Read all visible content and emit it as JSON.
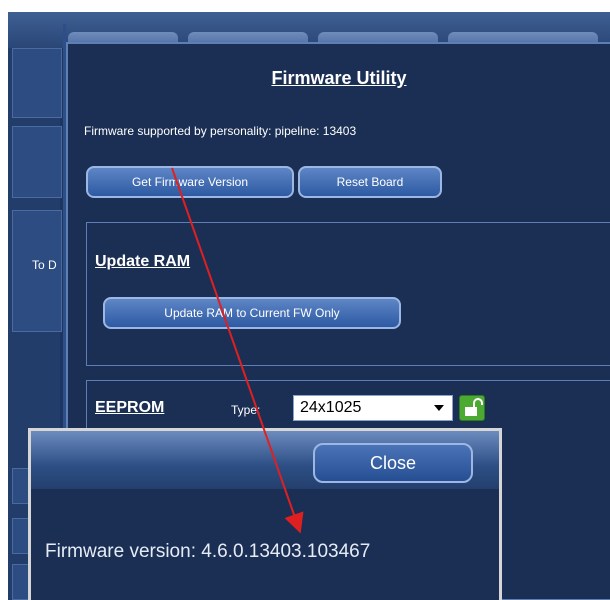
{
  "background": {
    "left_label": "To D"
  },
  "firmware_utility": {
    "title": "Firmware Utility",
    "supported_text": "Firmware supported by personality:  pipeline: 13403",
    "get_version_button": "Get Firmware Version",
    "reset_button": "Reset Board"
  },
  "update_ram": {
    "title": "Update RAM",
    "button": "Update RAM to Current FW Only"
  },
  "eeprom": {
    "title": "EEPROM",
    "type_label": "Type:",
    "type_value": "24x1025",
    "lock_icon": "unlocked-padlock-icon"
  },
  "popup": {
    "close_button": "Close",
    "message": "Firmware version: 4.6.0.13403.103467"
  },
  "colors": {
    "panel_bg": "#1b2f55",
    "button_gradient_top": "#5e86c6",
    "button_gradient_bottom": "#2d5aa3",
    "arrow": "#e02020",
    "lock_green": "#4caa32"
  }
}
